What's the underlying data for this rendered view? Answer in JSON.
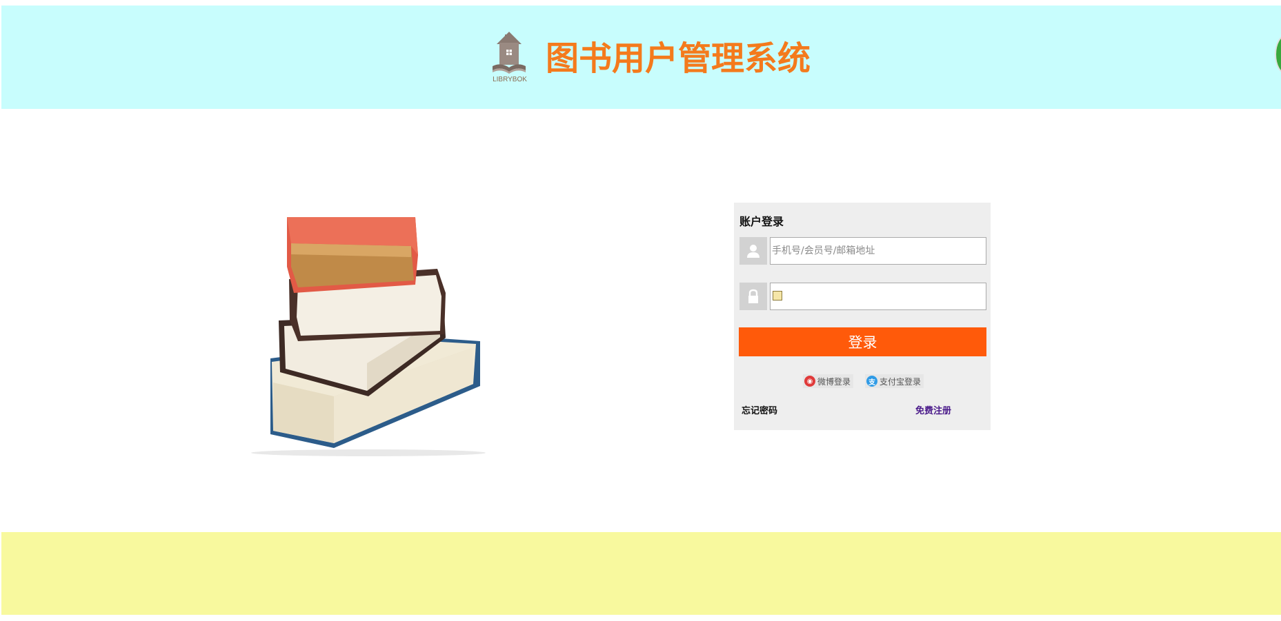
{
  "header": {
    "logo_text": "LIBRYBOK",
    "title": "图书用户管理系统"
  },
  "login": {
    "title": "账户登录",
    "username_placeholder": "手机号/会员号/邮箱地址",
    "password_value": "",
    "submit_label": "登录",
    "weibo_label": "微博登录",
    "alipay_label": "支付宝登录",
    "forgot_label": "忘记密码",
    "register_label": "免费注册"
  },
  "colors": {
    "header_bg": "#c8fdfd",
    "title": "#f47a1c",
    "button": "#ff5a0a",
    "footer_bg": "#f8f99e"
  },
  "icons": {
    "logo": "house-book-logo",
    "user": "user-icon",
    "lock": "lock-icon",
    "weibo": "weibo-icon",
    "alipay": "alipay-icon"
  }
}
